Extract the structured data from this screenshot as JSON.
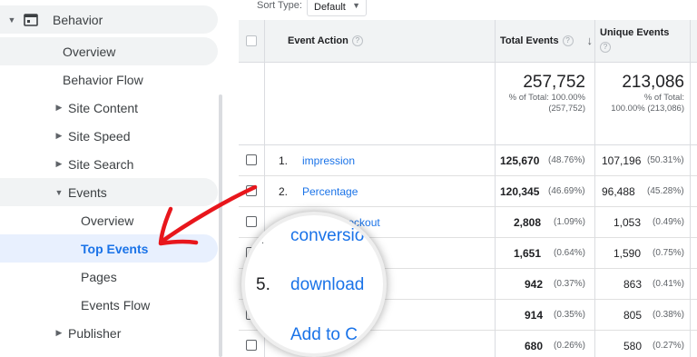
{
  "sidebar": {
    "items": [
      {
        "label": "Behavior"
      },
      {
        "label": "Overview"
      },
      {
        "label": "Behavior Flow"
      },
      {
        "label": "Site Content"
      },
      {
        "label": "Site Speed"
      },
      {
        "label": "Site Search"
      },
      {
        "label": "Events"
      },
      {
        "label": "Overview"
      },
      {
        "label": "Top Events"
      },
      {
        "label": "Pages"
      },
      {
        "label": "Events Flow"
      },
      {
        "label": "Publisher"
      }
    ]
  },
  "sort": {
    "label": "Sort Type:",
    "value": "Default"
  },
  "table": {
    "col_event_action": "Event Action",
    "col_total_events": "Total Events",
    "col_unique_events": "Unique Events",
    "totals": {
      "total": "257,752",
      "total_pct_line1": "% of Total: 100.00%",
      "total_pct_line2": "(257,752)",
      "unique": "213,086",
      "unique_pct_line1": "% of Total:",
      "unique_pct_line2": "100.00% (213,086)"
    },
    "rows": [
      {
        "num": "1.",
        "name": "impression",
        "total": "125,670",
        "total_pct": "(48.76%)",
        "unique": "107,196",
        "unique_pct": "(50.31%)"
      },
      {
        "num": "2.",
        "name": "Percentage",
        "total": "120,345",
        "total_pct": "(46.69%)",
        "unique": "96,488",
        "unique_pct": "(45.28%)"
      },
      {
        "num": "",
        "name": "Checkout",
        "total": "2,808",
        "total_pct": "(1.09%)",
        "unique": "1,053",
        "unique_pct": "(0.49%)"
      },
      {
        "num": "",
        "name": "",
        "total": "1,651",
        "total_pct": "(0.64%)",
        "unique": "1,590",
        "unique_pct": "(0.75%)"
      },
      {
        "num": "",
        "name": "",
        "total": "942",
        "total_pct": "(0.37%)",
        "unique": "863",
        "unique_pct": "(0.41%)"
      },
      {
        "num": "",
        "name": "",
        "total": "914",
        "total_pct": "(0.35%)",
        "unique": "805",
        "unique_pct": "(0.38%)"
      },
      {
        "num": "",
        "name": "",
        "total": "680",
        "total_pct": "(0.26%)",
        "unique": "580",
        "unique_pct": "(0.27%)"
      }
    ]
  },
  "magnifier": {
    "line1": "conversio",
    "num": "5.",
    "line2": "download",
    "line3": "Add to C"
  },
  "colors": {
    "link": "#1a73e8",
    "arrow": "#e8161c",
    "selected_bg": "#e8f0fe"
  },
  "icons": {
    "report": "report-window-icon",
    "arrow": "red-callout-arrow"
  }
}
